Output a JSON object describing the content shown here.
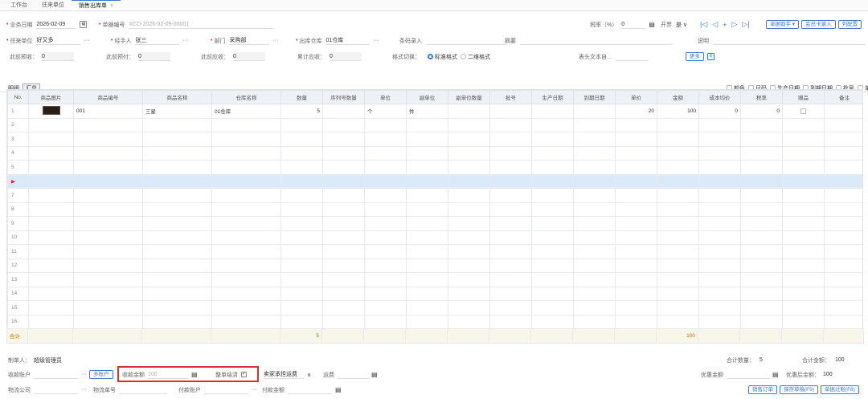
{
  "tabs": [
    "工作台",
    "往来单位",
    "销售出库单"
  ],
  "header": {
    "biz_date_label": "业务日期",
    "biz_date": "2026-02-09",
    "doc_no_label": "单据编号",
    "doc_no": "XCD-2026-02-09-00001",
    "tax_rate_label": "税率（%）",
    "tax_rate": "0",
    "invoice_label": "开票",
    "invoice_value": "是",
    "assistant_btn": "单据助手",
    "member_btn": "会员卡录入",
    "col_config_btn": "列配置",
    "partner_label": "往来单位",
    "partner": "好又多",
    "handler_label": "经手人",
    "handler": "张三",
    "dept_label": "部门",
    "dept": "采购部",
    "warehouse_label": "出库仓库",
    "warehouse": "01仓库",
    "barcode_label": "条码录入",
    "summary_label": "摘要",
    "note_label": "说明",
    "prev_receipt_label": "此前预收：",
    "prev_receipt": "0",
    "prev_payment_label": "此前预付：",
    "prev_payment": "0",
    "prev_receivable_label": "此前应收：",
    "prev_receivable": "0",
    "total_receivable_label": "累计应收：",
    "total_receivable": "0",
    "format_label": "格式切换：",
    "format_std": "标准格式",
    "format_2d": "二维格式",
    "header_text_label": "表头文本自...",
    "more_btn": "更多"
  },
  "subtabs": [
    "明细",
    "汇总"
  ],
  "options": [
    "颜色",
    "尺码",
    "生产日期",
    "到期日期",
    "批号",
    "单"
  ],
  "columns": [
    "No.",
    "商品图片",
    "商品编号",
    "商品名称",
    "仓库名称",
    "数量",
    "序列号数量",
    "单位",
    "副单位",
    "副单位数量",
    "批号",
    "生产日期",
    "到期日期",
    "单价",
    "金额",
    "成本均价",
    "税率",
    "赠品",
    "备注"
  ],
  "row1": {
    "no": "1",
    "code": "001",
    "name": "三星",
    "warehouse": "01仓库",
    "qty": "5",
    "unit": "个",
    "sub_unit": "件",
    "price": "20",
    "amount": "100",
    "cost": "0",
    "tax": "0"
  },
  "row_numbers": [
    "2",
    "3",
    "4",
    "5",
    "",
    "7",
    "8",
    "9",
    "10",
    "11",
    "12",
    "13",
    "14",
    "15",
    "16"
  ],
  "totals": {
    "label": "合计",
    "qty": "5",
    "amount": "100"
  },
  "footer": {
    "creator_label": "制单人：",
    "creator": "超级管理员",
    "total_qty_label": "合计数量：",
    "total_qty": "5",
    "total_amount_label": "合计金额：",
    "total_amount": "100",
    "account_label": "收款账户",
    "multi_account_btn": "多账户",
    "receipt_amount_label": "收款金额",
    "receipt_amount": "100",
    "settle_label": "整单结清",
    "shipping_mode": "卖家承担运费",
    "freight_label": "运费",
    "discount_label": "优惠金额",
    "after_discount_label": "优惠后金额：",
    "after_discount": "100",
    "logistics_label": "物流公司",
    "tracking_label": "物流单号",
    "pay_account_label": "付款账户",
    "pay_amount_label": "付款金额",
    "btn_sales_order": "销售订单",
    "btn_save_draft": "保存草稿(F9)",
    "btn_post": "单据过账(F8)"
  },
  "colors": {
    "accent": "#3a7bd5",
    "required": "#e22233",
    "highlight": "#d93030"
  }
}
